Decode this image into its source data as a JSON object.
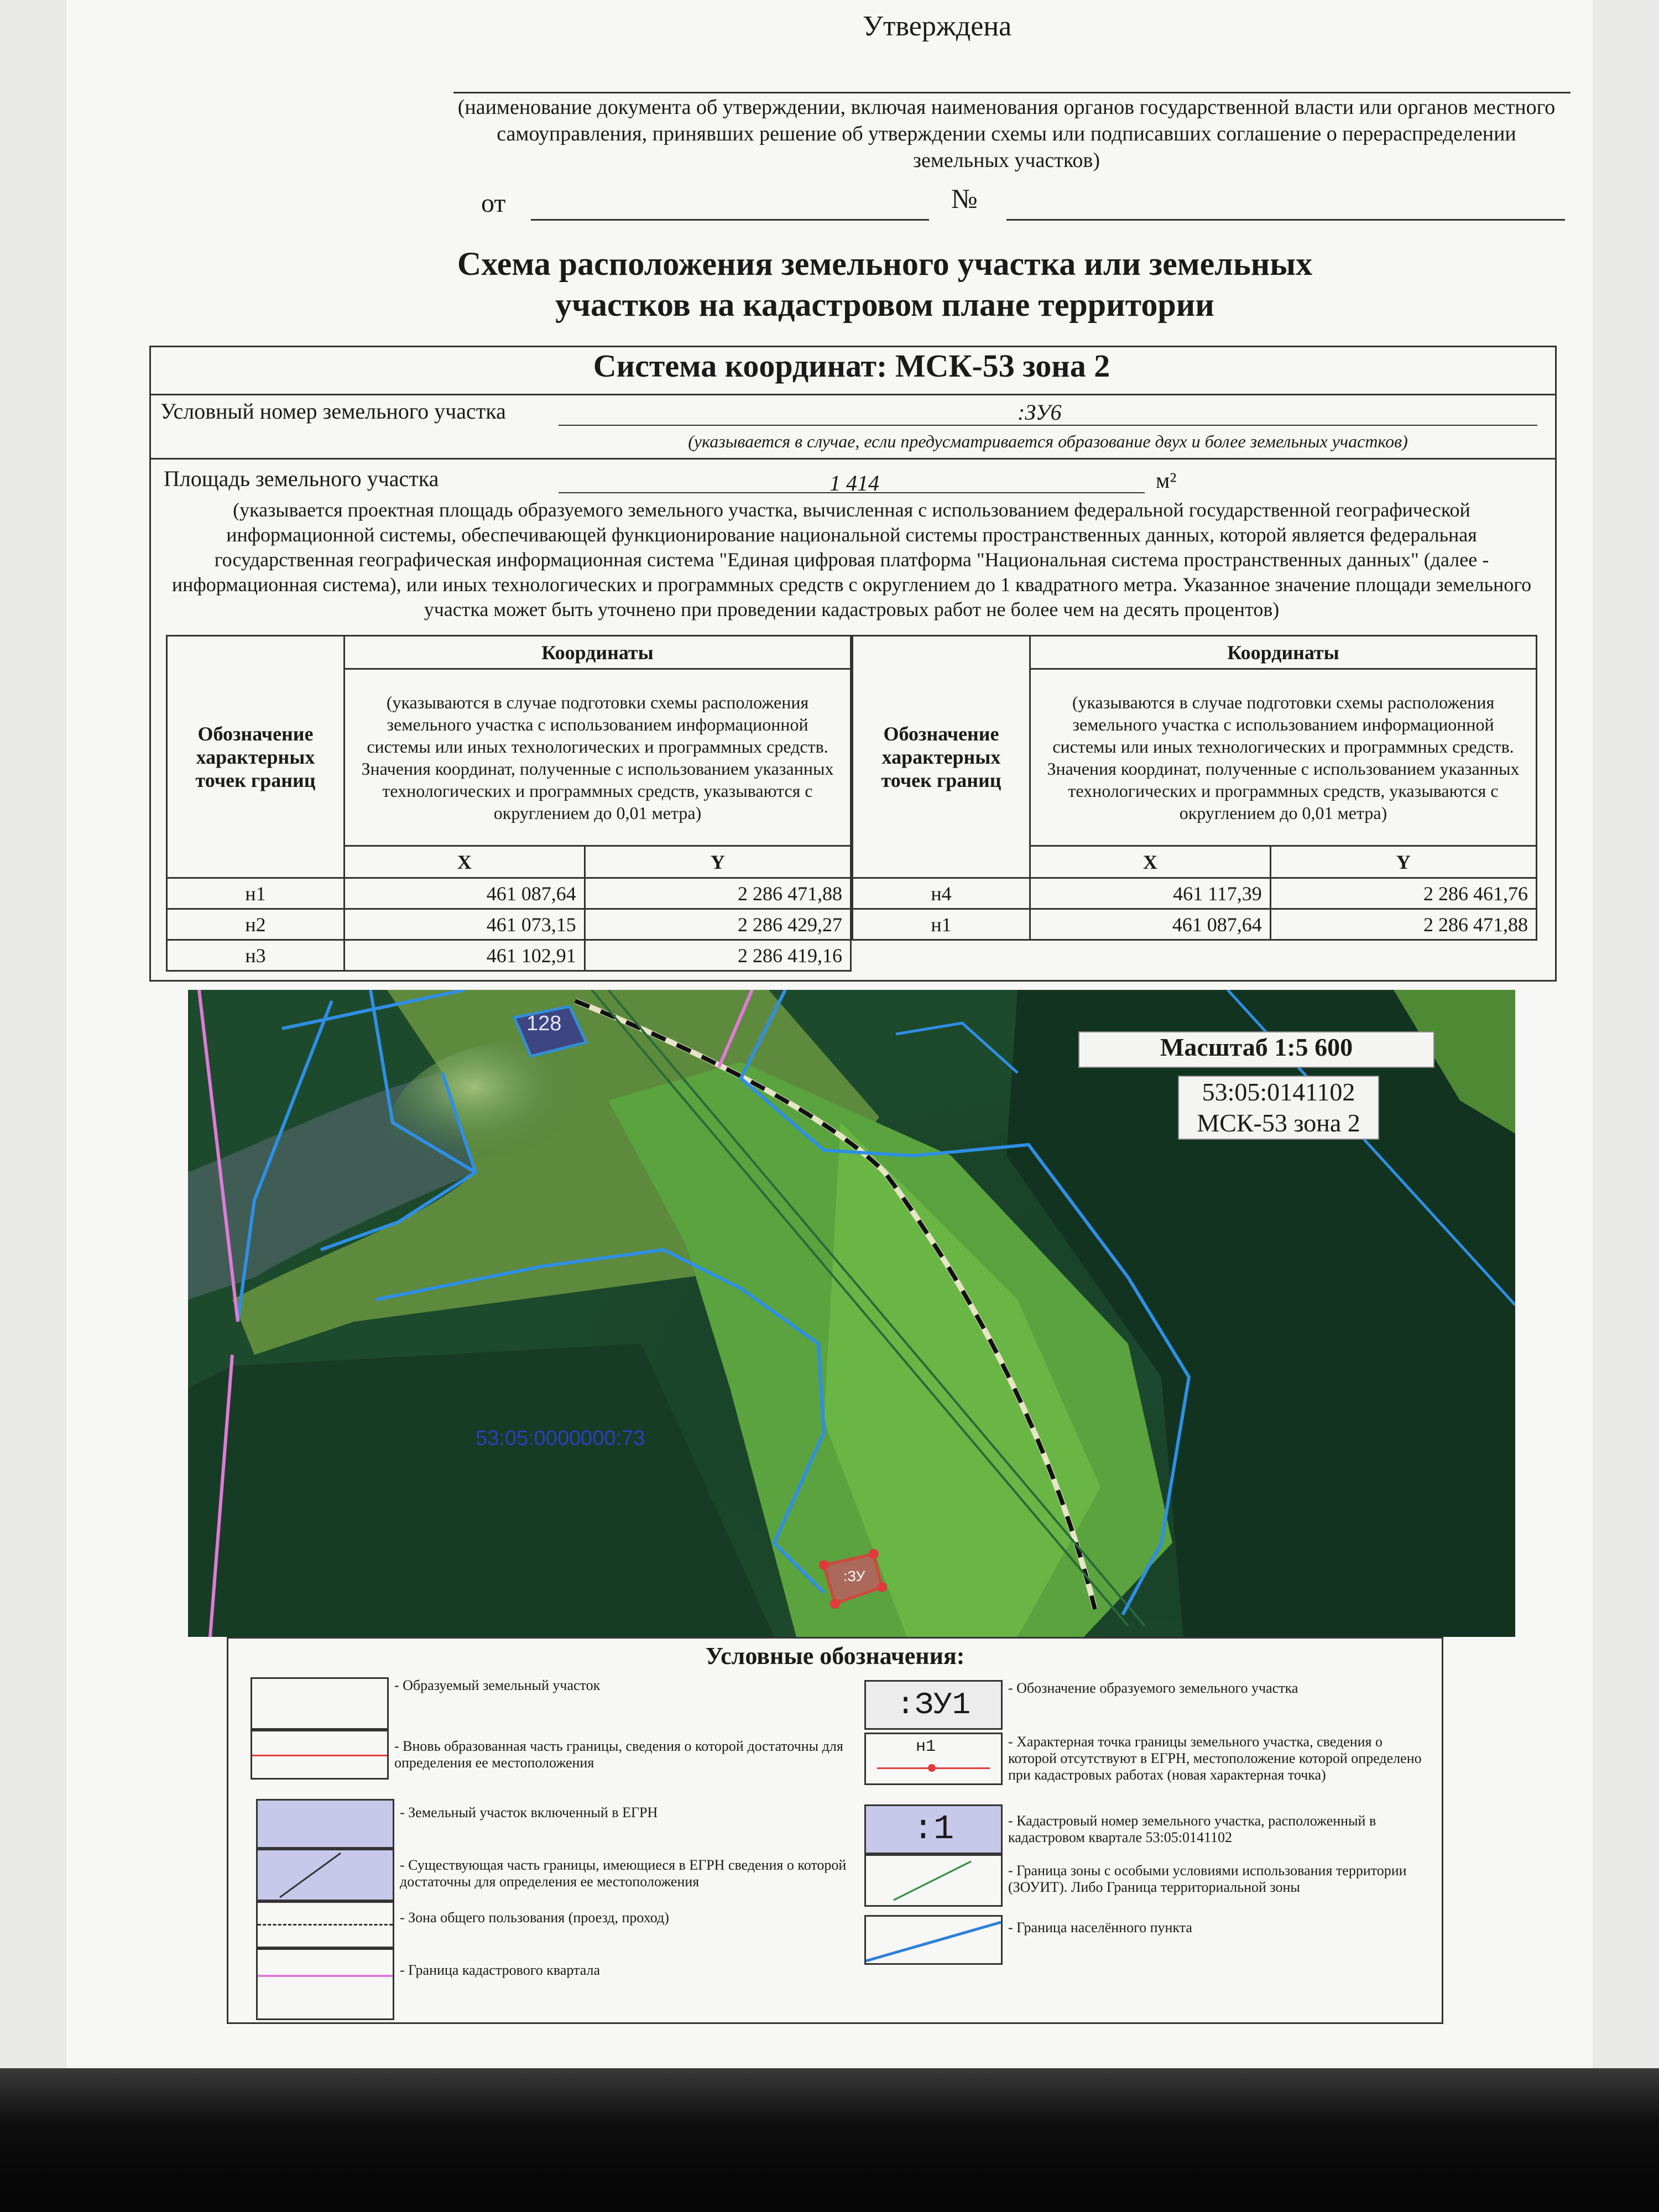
{
  "header": {
    "approved": "Утверждена",
    "doc_note": "(наименование документа об утверждении, включая наименования органов государственной власти или органов местного самоуправления, принявших решение об утверждении схемы или подписавших соглашение о перераспределении земельных участков)",
    "from": "от",
    "number": "№"
  },
  "title": {
    "line1": "Схема расположения земельного участка или земельных",
    "line2": "участков на кадастровом плане территории"
  },
  "coord_system": "Система координат: МСК-53 зона 2",
  "parcel": {
    "number_label": "Условный номер земельного участка",
    "number_value": ":ЗУ6",
    "number_note": "(указывается в случае, если предусматривается образование двух и более земельных участков)",
    "area_label": "Площадь земельного участка",
    "area_value": "1 414",
    "area_unit": "м²",
    "area_note": "(указывается проектная площадь образуемого земельного участка, вычисленная с использованием федеральной государственной географической информационной системы, обеспечивающей функционирование национальной системы пространственных данных, которой является федеральная государственная географическая информационная система \"Единая цифровая платформа \"Национальная система пространственных данных\" (далее - информационная система), или иных технологических и программных средств с округлением до 1 квадратного метра. Указанное значение площади земельного участка может быть уточнено при проведении кадастровых работ не более чем на десять процентов)"
  },
  "table": {
    "points_header": "Обозначение характерных точек границ",
    "coords_header": "Координаты",
    "coords_note": "(указываются в случае подготовки схемы расположения земельного участка с использованием информационной системы или иных технологических и программных средств. Значения координат, полученные с использованием указанных технологических и программных средств, указываются с округлением до 0,01 метра)",
    "x": "X",
    "y": "Y",
    "left_rows": [
      {
        "p": "н1",
        "x": "461 087,64",
        "y": "2 286 471,88"
      },
      {
        "p": "н2",
        "x": "461 073,15",
        "y": "2 286 429,27"
      },
      {
        "p": "н3",
        "x": "461 102,91",
        "y": "2 286 419,16"
      }
    ],
    "right_rows": [
      {
        "p": "н4",
        "x": "461 117,39",
        "y": "2 286 461,76"
      },
      {
        "p": "н1",
        "x": "461 087,64",
        "y": "2 286 471,88"
      }
    ]
  },
  "map": {
    "scale": "Масштаб 1:5 600",
    "quarter": "53:05:0141102",
    "system": "МСК-53 зона 2",
    "parcel_128": "128",
    "parcel_code": "53:05:0000000:73",
    "zu_label": ":ЗУ",
    "colors": {
      "boundary": "#2f8fe6",
      "quarter": "#e07ad8",
      "new_parcel": "#e23a3a"
    }
  },
  "legend": {
    "title": "Условные обозначения:",
    "items": [
      "- Образуемый земельный участок",
      "- Вновь образованная часть границы, сведения о которой достаточны для определения ее местоположения",
      "- Земельный участок включенный в ЕГРН",
      "- Существующая часть границы, имеющиеся в ЕГРН сведения о которой достаточны для определения ее местоположения",
      "- Зона общего пользования (проезд, проход)",
      "- Граница кадастрового квартала",
      "- Обозначение образуемого земельного участка",
      "- Характерная точка границы земельного участка, сведения о которой отсутствуют в ЕГРН, местоположение которой определено при кадастровых работах (новая характерная точка)",
      "- Кадастровый номер земельного участка, расположенный в кадастровом квартале 53:05:0141102",
      "- Граница зоны с особыми условиями использования территории (ЗОУИТ). Либо Граница территориальной зоны",
      "- Граница населённого пункта"
    ],
    "swatch_zu": ":ЗУ1",
    "swatch_point": "н1",
    "swatch_cad": ":1"
  }
}
